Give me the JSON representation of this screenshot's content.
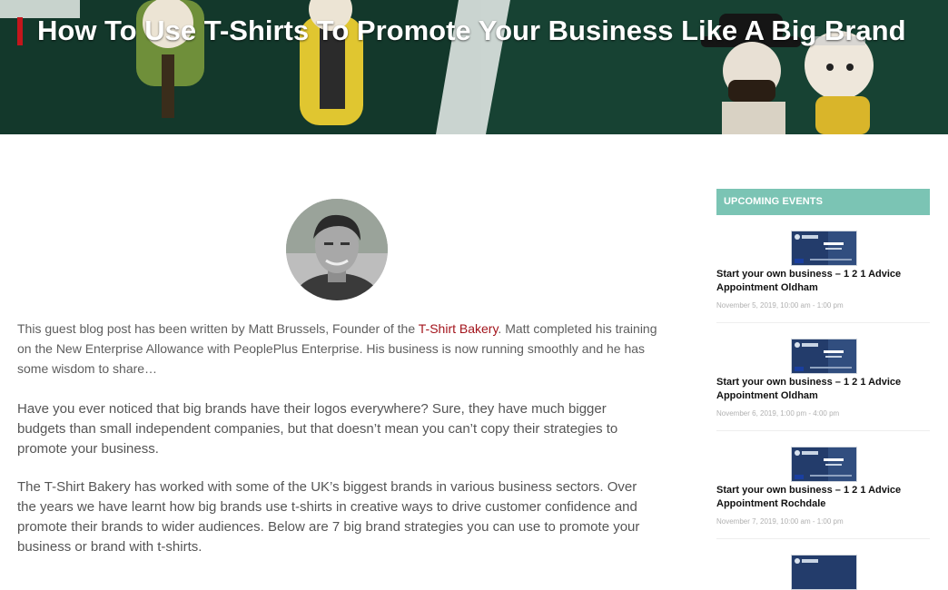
{
  "page": {
    "title": "How To Use T-Shirts To Promote Your Business Like A Big Brand"
  },
  "article": {
    "intro_prefix": "This guest blog post has been written by Matt Brussels, Founder of the ",
    "intro_link": "T-Shirt Bakery",
    "intro_suffix": ". Matt completed his training on the New Enterprise Allowance with PeoplePlus Enterprise. His business is now running smoothly and he has some wisdom to share…",
    "paragraph_2": "Have you ever noticed that big brands have their logos everywhere? Sure, they have much bigger budgets than small independent companies, but that doesn’t mean you can’t copy their strategies to promote your business.",
    "paragraph_3": "The T-Shirt Bakery has worked with some of the UK’s biggest brands in various business sectors. Over the years we have learnt how big brands use t-shirts in creative ways to drive customer confidence and promote their brands to wider audiences. Below are 7 big brand strategies you can use to promote your business or brand with t-shirts."
  },
  "sidebar": {
    "heading": "UPCOMING EVENTS",
    "events": [
      {
        "title": "Start your own business – 1 2 1 Advice Appointment Oldham",
        "date": "November 5, 2019, 10:00 am - 1:00 pm"
      },
      {
        "title": "Start your own business – 1 2 1 Advice Appointment Oldham",
        "date": "November 6, 2019, 1:00 pm - 4:00 pm"
      },
      {
        "title": "Start your own business – 1 2 1 Advice Appointment Rochdale",
        "date": "November 7, 2019, 10:00 am - 1:00 pm"
      }
    ]
  },
  "colors": {
    "accent_red": "#c4161c",
    "link_red": "#a3141c",
    "events_header": "#7bc4b4",
    "hero_green": "#13382b"
  },
  "icons": {
    "avatar": "author-avatar",
    "event_thumbnail": "event-banner-thumbnail"
  }
}
